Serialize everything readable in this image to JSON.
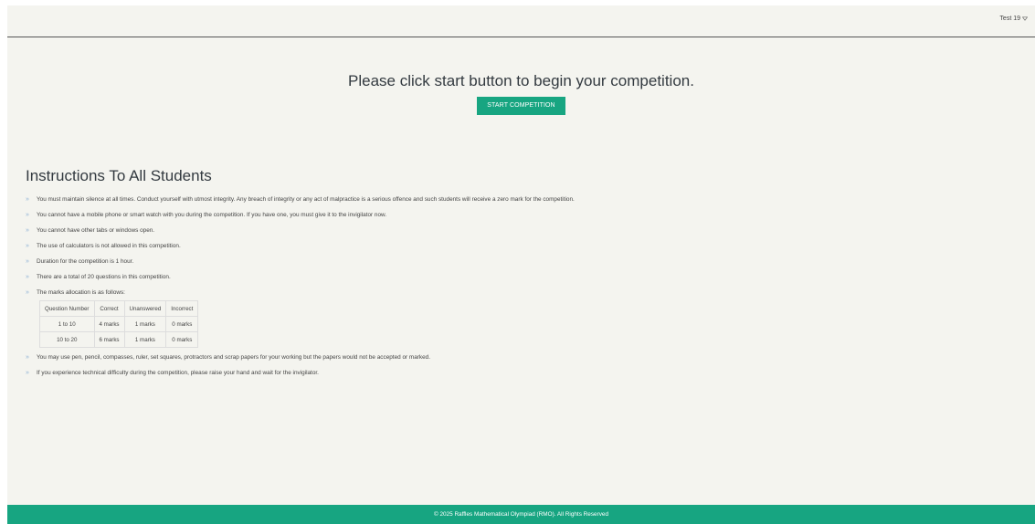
{
  "header": {
    "user_label": "Test 19",
    "user_menu_icon": "chevron-down-icon"
  },
  "hero": {
    "message": "Please click start button to begin your competition.",
    "start_button_label": "START COMPETITION"
  },
  "instructions": {
    "title": "Instructions To All Students",
    "items_before_table": [
      "You must maintain silence at all times. Conduct yourself with utmost integrity. Any breach of integrity or any act of malpractice is a serious offence and such students will receive a zero mark for the competition.",
      "You cannot have a mobile phone or smart watch with you during the competition. If you have one, you must give it to the invigilator now.",
      "You cannot have other tabs or windows open.",
      "The use of calculators is not allowed in this competition.",
      "Duration for the competition is 1 hour.",
      "There are a total of 20 questions in this competition.",
      "The marks allocation is as follows:"
    ],
    "marks_table": {
      "headers": [
        "Question Number",
        "Correct",
        "Unanswered",
        "Incorrect"
      ],
      "rows": [
        [
          "1 to 10",
          "4 marks",
          "1 marks",
          "0 marks"
        ],
        [
          "10 to 20",
          "6 marks",
          "1 marks",
          "0 marks"
        ]
      ]
    },
    "items_after_table": [
      "You may use pen, pencil, compasses, ruler, set squares, protractors and scrap papers for your working but the papers would not be accepted or marked.",
      "If you experience technical difficulty during the competition, please raise your hand and wait for the invigilator."
    ],
    "bullet_icon": "double-chevron-right-icon"
  },
  "footer": {
    "text": "© 2025 Raffles Mathematical Olympiad (RMO). All Rights Reserved"
  },
  "colors": {
    "accent": "#17a581",
    "background": "#f4f4ef",
    "bullet": "#8fb3d6"
  }
}
